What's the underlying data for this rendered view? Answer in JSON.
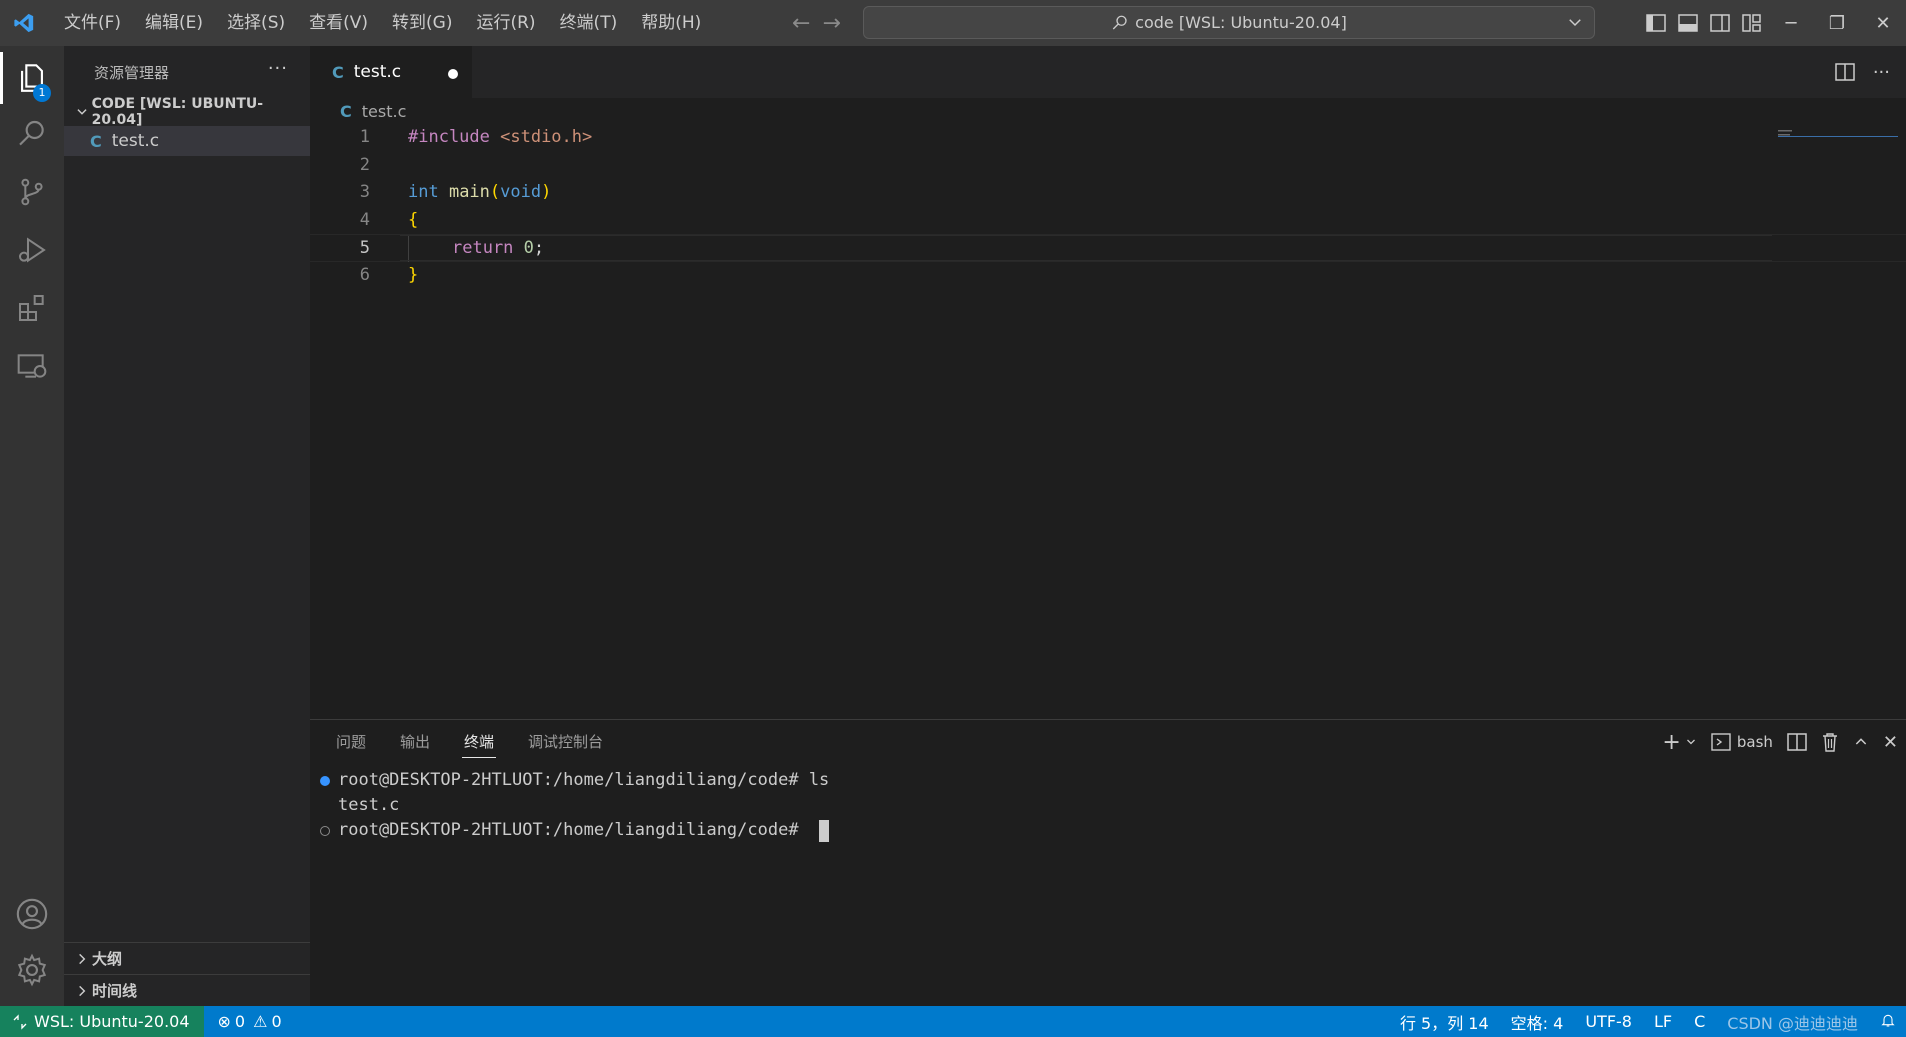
{
  "titlebar": {
    "menu": [
      "文件(F)",
      "编辑(E)",
      "选择(S)",
      "查看(V)",
      "转到(G)",
      "运行(R)",
      "终端(T)",
      "帮助(H)"
    ],
    "search_text": "code [WSL: Ubuntu-20.04]",
    "back_icon": "arrow-left-icon",
    "forward_icon": "arrow-right-icon"
  },
  "activity_bar": {
    "items": [
      "explorer-icon",
      "search-icon",
      "source-control-icon",
      "run-debug-icon",
      "extensions-icon",
      "remote-explorer-icon"
    ],
    "explorer_badge": "1",
    "bottom": [
      "account-icon",
      "gear-icon"
    ]
  },
  "sidebar": {
    "title": "资源管理器",
    "more": "···",
    "folder_label": "CODE [WSL: UBUNTU-20.04]",
    "files": [
      {
        "icon": "C",
        "name": "test.c"
      }
    ],
    "outline_label": "大纲",
    "timeline_label": "时间线"
  },
  "editor": {
    "tab": {
      "icon": "C",
      "label": "test.c",
      "dirty": true
    },
    "breadcrumb": {
      "icon": "C",
      "label": "test.c"
    },
    "line_numbers": [
      "1",
      "2",
      "3",
      "4",
      "5",
      "6"
    ],
    "current_line": 5,
    "code": {
      "l1_pre": "#include",
      "l1_str": " <stdio.h>",
      "l3_type": "int",
      "l3_fn": " main",
      "l3_open": "(",
      "l3_void": "void",
      "l3_close": ")",
      "l4": "{",
      "l5_kw": "return",
      "l5_num": " 0",
      "l5_end": ";",
      "l6": "}"
    }
  },
  "panel": {
    "tabs": [
      "问题",
      "输出",
      "终端",
      "调试控制台"
    ],
    "active_tab": "终端",
    "shell_label": "bash",
    "terminal": {
      "line1_prompt": "root@DESKTOP-2HTLUOT:/home/liangdiliang/code# ",
      "line1_cmd": "ls",
      "line2": "test.c",
      "line3_prompt": "root@DESKTOP-2HTLUOT:/home/liangdiliang/code# "
    }
  },
  "statusbar": {
    "remote": "WSL: Ubuntu-20.04",
    "errors": "0",
    "warnings": "0",
    "position": "行 5，列 14",
    "spaces": "空格: 4",
    "encoding": "UTF-8",
    "eol": "LF",
    "language": "C",
    "watermark": "CSDN @迪迪迪迪"
  },
  "colors": {
    "accent": "#007acc",
    "remote": "#16825d",
    "c_icon": "#519aba"
  }
}
